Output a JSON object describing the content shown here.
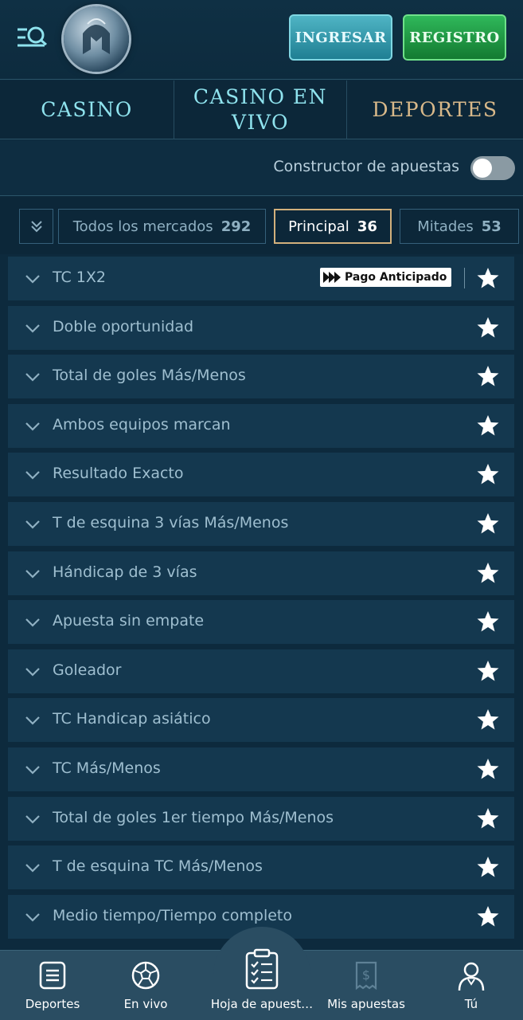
{
  "header": {
    "ingresar_label": "INGRESAR",
    "registro_label": "REGISTRO"
  },
  "nav": {
    "casino": "CASINO",
    "casino_en_vivo": "CASINO EN VIVO",
    "deportes": "DEPORTES"
  },
  "constructor": {
    "label": "Constructor de apuestas",
    "enabled": false
  },
  "filters": [
    {
      "label": "Todos los mercados",
      "count": "292",
      "active": false
    },
    {
      "label": "Principal",
      "count": "36",
      "active": true
    },
    {
      "label": "Mitades",
      "count": "53",
      "active": false
    }
  ],
  "badge": {
    "label": "Pago Anticipado"
  },
  "markets": [
    {
      "label": "TC 1X2"
    },
    {
      "label": "Doble oportunidad"
    },
    {
      "label": "Total de goles Más/Menos"
    },
    {
      "label": "Ambos equipos marcan"
    },
    {
      "label": "Resultado Exacto"
    },
    {
      "label": "T de esquina 3 vías Más/Menos"
    },
    {
      "label": "Hándicap de 3 vías"
    },
    {
      "label": "Apuesta sin empate"
    },
    {
      "label": "Goleador"
    },
    {
      "label": "TC Handicap asiático"
    },
    {
      "label": "TC Más/Menos"
    },
    {
      "label": "Total de goles 1er tiempo Más/Menos"
    },
    {
      "label": "T de esquina TC Más/Menos"
    },
    {
      "label": "Medio tiempo/Tiempo completo"
    }
  ],
  "bottom_nav": {
    "deportes": "Deportes",
    "en_vivo": "En vivo",
    "hoja": "Hoja de apuest…",
    "mis_apuestas": "Mis apuestas",
    "tu": "Tú"
  },
  "colors": {
    "background": "#0d2a3d",
    "row": "#14384f",
    "accent_cyan": "#8fe3ee",
    "accent_gold": "#d9b98a",
    "ingresar": "#1f7f93",
    "registro": "#137a31"
  }
}
